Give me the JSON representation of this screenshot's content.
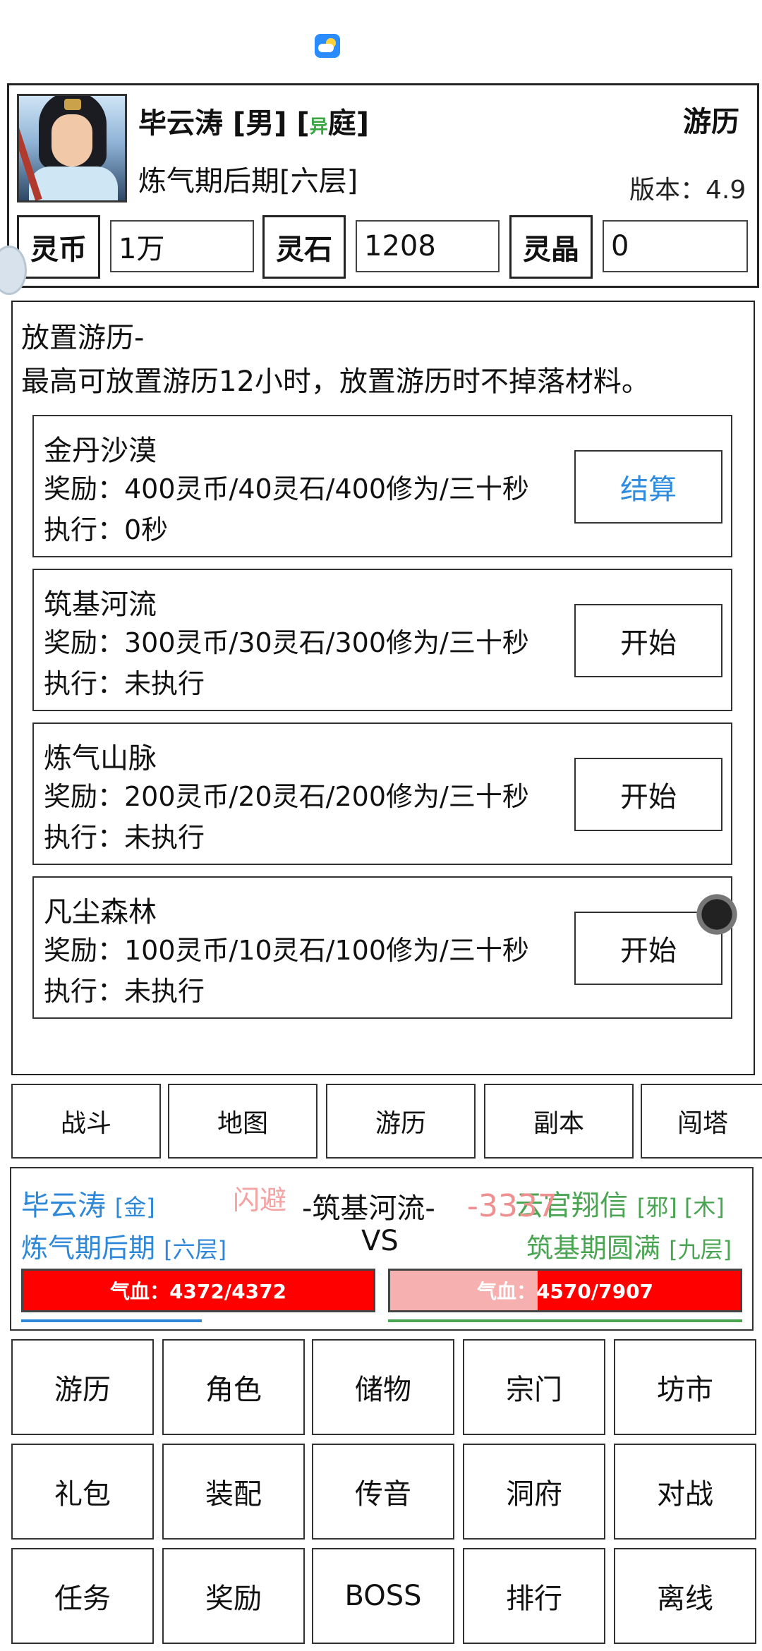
{
  "colors": {
    "accent_blue": "#2e87d7",
    "accent_green": "#4aa552",
    "hp_red": "#ff0000",
    "hp_empty": "#f7b0b0"
  },
  "header": {
    "player_name": "毕云涛 [男] [",
    "overlay_tag": "异",
    "overlay_tail": "庭]",
    "title_right": "游历",
    "realm": "炼气期后期[六层]",
    "version": "版本：4.9",
    "currencies": [
      {
        "label": "灵币",
        "value": "1万"
      },
      {
        "label": "灵石",
        "value": "1208"
      },
      {
        "label": "灵晶",
        "value": "0"
      }
    ]
  },
  "panel": {
    "title": "放置游历-",
    "desc": "最高可放置游历12小时，放置游历时不掉落材料。",
    "routes": [
      {
        "name": "金丹沙漠",
        "reward": "奖励：400灵币/40灵石/400修为/三十秒",
        "exec": "执行：0秒",
        "button": "结算"
      },
      {
        "name": "筑基河流",
        "reward": "奖励：300灵币/30灵石/300修为/三十秒",
        "exec": "执行：未执行",
        "button": "开始"
      },
      {
        "name": "炼气山脉",
        "reward": "奖励：200灵币/20灵石/200修为/三十秒",
        "exec": "执行：未执行",
        "button": "开始"
      },
      {
        "name": "凡尘森林",
        "reward": "奖励：100灵币/10灵石/100修为/三十秒",
        "exec": "执行：未执行",
        "button": "开始"
      }
    ]
  },
  "tabs": [
    "战斗",
    "地图",
    "游历",
    "副本",
    "闯塔"
  ],
  "battle": {
    "left_name": "毕云涛",
    "left_tag": "[金]",
    "left_realm": "炼气期后期",
    "left_layer": "[六层]",
    "dodge": "闪避",
    "location": "-筑基河流-",
    "vs": "VS",
    "damage": "-3337",
    "right_name": "云官翔信",
    "right_tags": "[邪] [木]",
    "right_realm": "筑基期圆满",
    "right_layer": "[九层]",
    "left_hp_text": "气血：4372/4372",
    "left_hp_fraction": 1.0,
    "right_hp_text": "气血：4570/7907",
    "right_hp_fraction": 0.578
  },
  "grid": [
    [
      "游历",
      "角色",
      "储物",
      "宗门",
      "坊市"
    ],
    [
      "礼包",
      "装配",
      "传音",
      "洞府",
      "对战"
    ],
    [
      "任务",
      "奖励",
      "BOSS",
      "排行",
      "离线"
    ]
  ]
}
